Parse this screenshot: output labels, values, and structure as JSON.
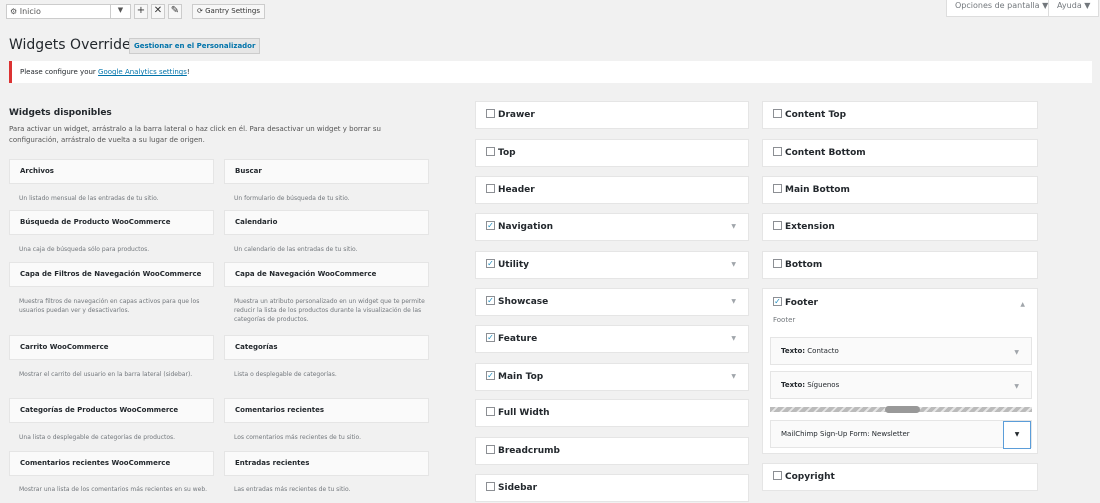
{
  "topbar": {
    "page_select": "Inicio",
    "add_label": "+",
    "delete_label": "✕",
    "edit_label": "✎",
    "gantry_label": "Gantry Settings",
    "screen_options": "Opciones de pantalla ▼",
    "help": "Ayuda ▼"
  },
  "header": {
    "title": "Widgets Override",
    "customizer_button": "Gestionar en el Personalizador"
  },
  "notice": {
    "prefix": "Please configure your ",
    "link": "Google Analytics settings",
    "suffix": "!"
  },
  "available": {
    "title": "Widgets disponibles",
    "description": "Para activar un widget, arrástralo a la barra lateral o haz click en él. Para desactivar un widget y borrar su configuración, arrástralo de vuelta a su lugar de origen.",
    "widgets": [
      {
        "name": "Archivos",
        "desc": "Un listado mensual de las entradas de tu sitio."
      },
      {
        "name": "Buscar",
        "desc": "Un formulario de búsqueda de tu sitio."
      },
      {
        "name": "Búsqueda de Producto WooCommerce",
        "desc": "Una caja de búsqueda sólo para productos."
      },
      {
        "name": "Calendario",
        "desc": "Un calendario de las entradas de tu sitio."
      },
      {
        "name": "Capa de Filtros de Navegación WooCommerce",
        "desc": "Muestra filtros de navegación en capas activos para que los usuarios puedan ver y desactivarlos."
      },
      {
        "name": "Capa de Navegación WooCommerce",
        "desc": "Muestra un atributo personalizado en un widget que te permite reducir la lista de los productos durante la visualización de las categorías de productos."
      },
      {
        "name": "Carrito WooCommerce",
        "desc": "Mostrar el carrito del usuario en la barra lateral (sidebar)."
      },
      {
        "name": "Categorías",
        "desc": "Lista o desplegable de categorías."
      },
      {
        "name": "Categorías de Productos WooCommerce",
        "desc": "Una lista o desplegable de categorías de productos."
      },
      {
        "name": "Comentarios recientes",
        "desc": "Los comentarios más recientes de tu sitio."
      },
      {
        "name": "Comentarios recientes WooCommerce",
        "desc": "Mostrar una lista de los comentarios más recientes en su web."
      },
      {
        "name": "Entradas recientes",
        "desc": "Las entradas más recientes de tu sitio."
      }
    ]
  },
  "sidebars_col1": [
    {
      "name": "Drawer",
      "checked": false
    },
    {
      "name": "Top",
      "checked": false
    },
    {
      "name": "Header",
      "checked": false
    },
    {
      "name": "Navigation",
      "checked": true
    },
    {
      "name": "Utility",
      "checked": true
    },
    {
      "name": "Showcase",
      "checked": true
    },
    {
      "name": "Feature",
      "checked": true
    },
    {
      "name": "Main Top",
      "checked": true
    },
    {
      "name": "Full Width",
      "checked": false
    },
    {
      "name": "Breadcrumb",
      "checked": false
    },
    {
      "name": "Sidebar",
      "checked": false
    }
  ],
  "sidebars_col2": [
    {
      "name": "Content Top",
      "checked": false
    },
    {
      "name": "Content Bottom",
      "checked": false
    },
    {
      "name": "Main Bottom",
      "checked": false
    },
    {
      "name": "Extension",
      "checked": false
    },
    {
      "name": "Bottom",
      "checked": false
    }
  ],
  "footer": {
    "name": "Footer",
    "checked": true,
    "description": "Footer",
    "widgets": [
      {
        "type": "Texto:",
        "title": "Contacto"
      },
      {
        "type": "Texto:",
        "title": "Síguenos"
      }
    ],
    "dragging": {
      "type": "MailChimp Sign-Up Form:",
      "title": "Newsletter"
    }
  },
  "copyright": {
    "name": "Copyright",
    "checked": false
  },
  "icons": {
    "check": "✓",
    "arrow_down": "▼",
    "arrow_up": "▲",
    "gear": "gear-icon",
    "refresh": "refresh-icon"
  }
}
